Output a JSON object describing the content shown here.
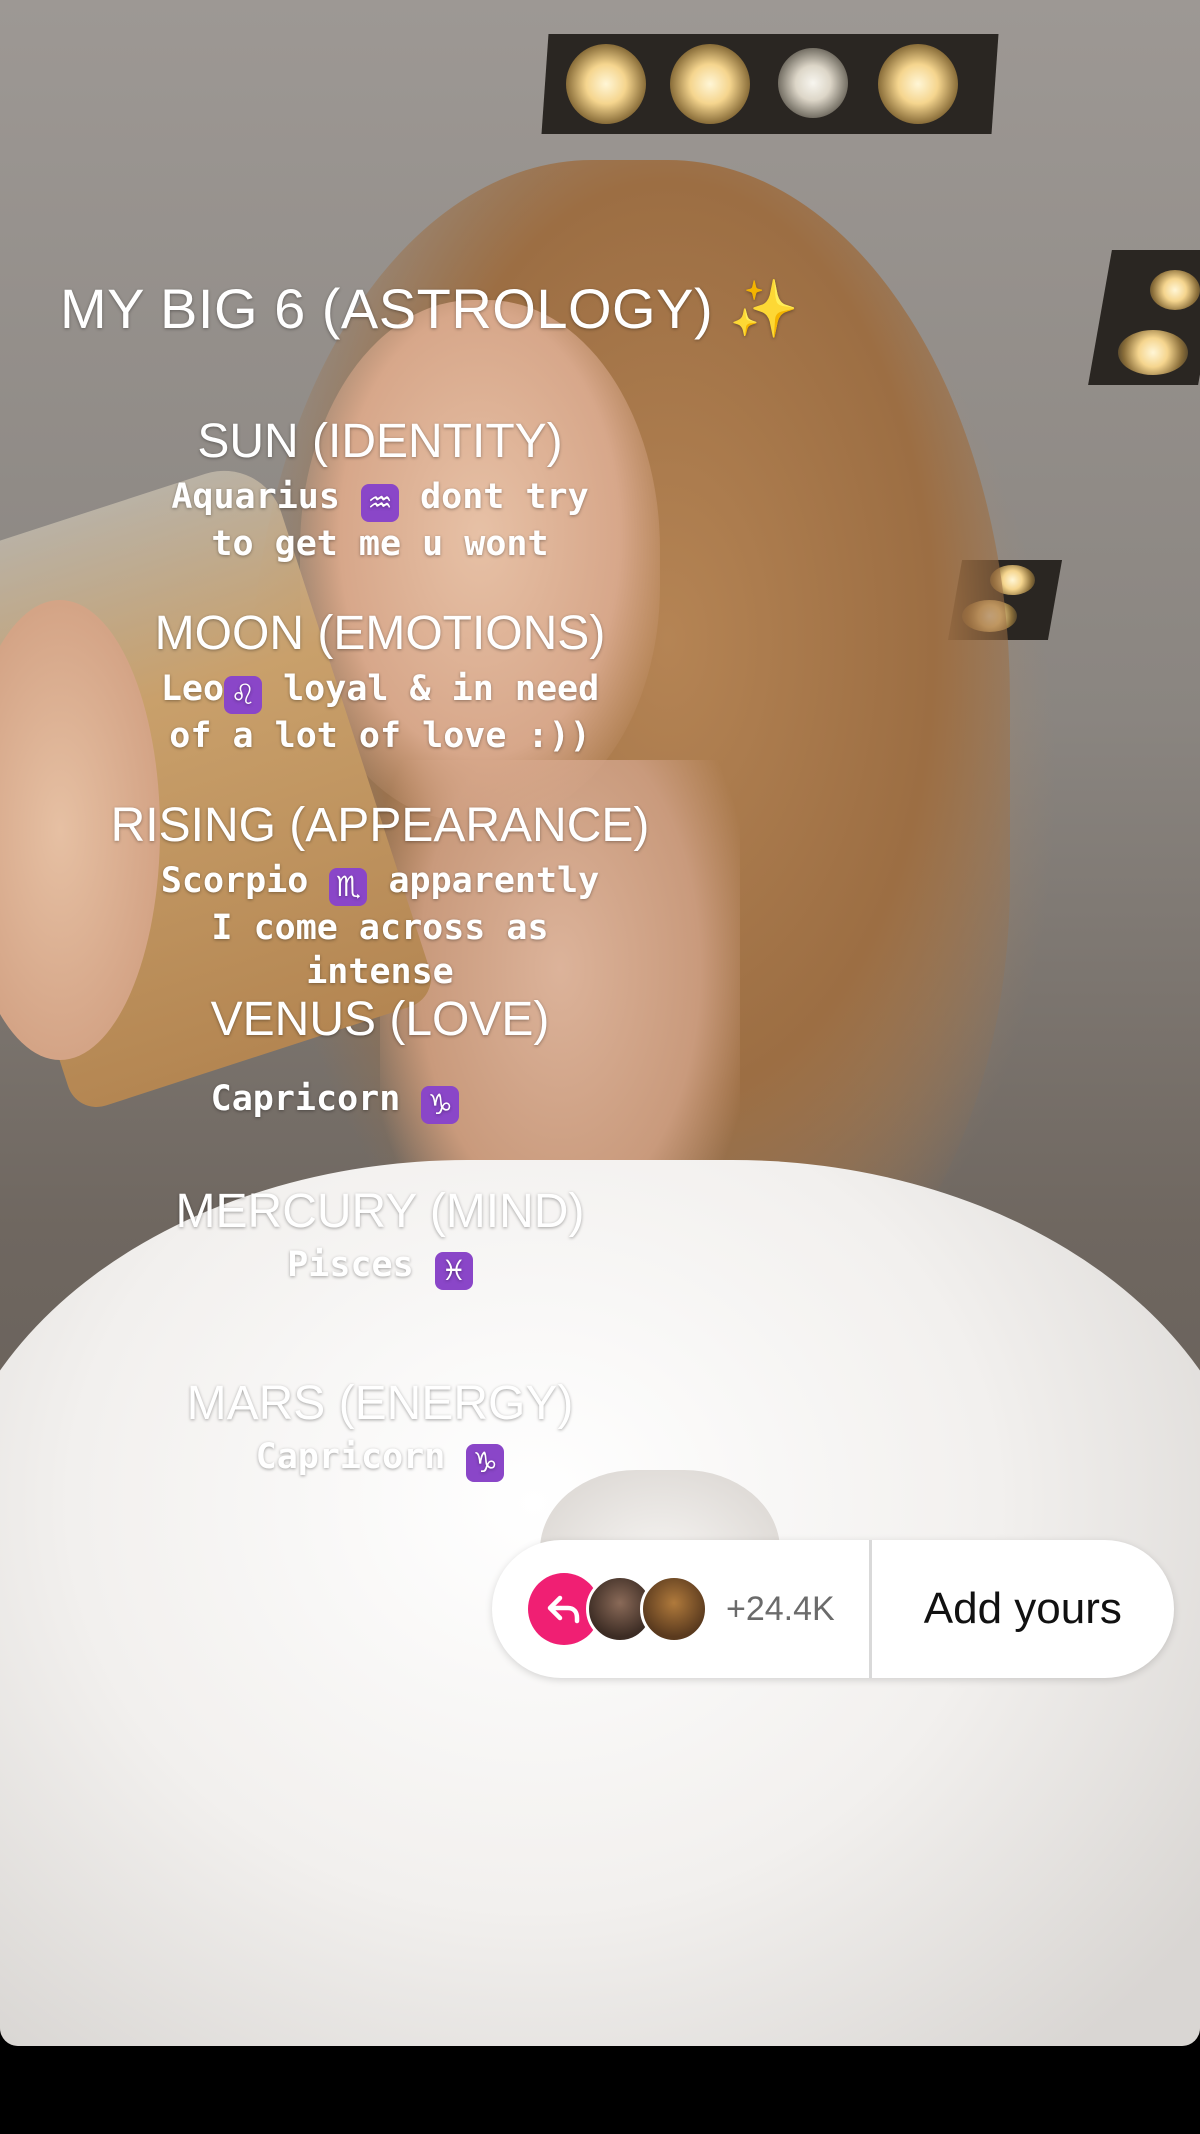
{
  "story": {
    "title": "MY BIG 6 (ASTROLOGY)",
    "title_emoji": "✨",
    "sections": [
      {
        "heading": "SUN (IDENTITY)",
        "lines": [
          [
            "Aquarius ",
            "♒",
            " dont try"
          ],
          [
            "to get me u wont"
          ]
        ]
      },
      {
        "heading": "MOON (EMOTIONS)",
        "lines": [
          [
            "Leo",
            "♌",
            " loyal & in need"
          ],
          [
            "of a lot of love :))"
          ]
        ]
      },
      {
        "heading": "RISING (APPEARANCE)",
        "lines": [
          [
            "Scorpio ",
            "♏",
            " apparently"
          ],
          [
            "I come across as"
          ],
          [
            "intense"
          ]
        ]
      },
      {
        "heading": "VENUS (LOVE)",
        "lines": [
          [
            "Capricorn ",
            "♑"
          ]
        ]
      },
      {
        "heading": "MERCURY (MIND)",
        "lines": [
          [
            "Pisces ",
            "♓"
          ]
        ]
      },
      {
        "heading": "MARS (ENERGY)",
        "lines": [
          [
            "Capricorn ",
            "♑"
          ]
        ]
      }
    ]
  },
  "add_yours": {
    "count": "+24.4K",
    "label": "Add yours"
  },
  "colors": {
    "accent_pink": "#f01f73",
    "zodiac_badge": "#8a46c8"
  },
  "icons": {
    "reply": "reply-arrow-icon",
    "sparkle": "sparkles-icon"
  }
}
